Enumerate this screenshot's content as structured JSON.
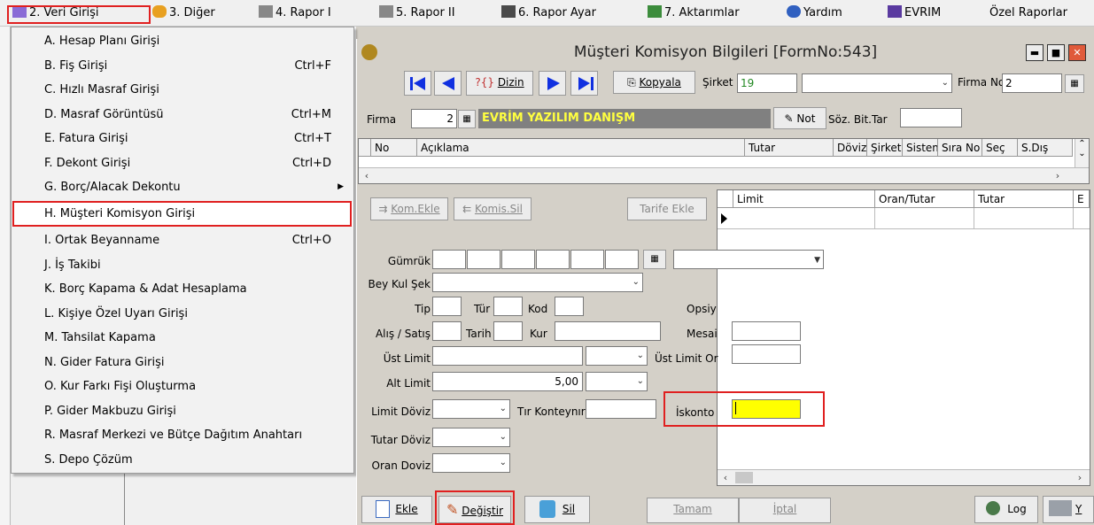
{
  "menubar": {
    "items": [
      {
        "label": "2.  Veri Girişi"
      },
      {
        "label": "3.  Diğer"
      },
      {
        "label": "4.  Rapor I"
      },
      {
        "label": "5.  Rapor II"
      },
      {
        "label": "6.  Rapor Ayar"
      },
      {
        "label": "7.  Aktarımlar"
      },
      {
        "label": "Yardım"
      },
      {
        "label": "EVRIM"
      },
      {
        "label": "Özel Raporlar"
      }
    ]
  },
  "dropdown": {
    "items": [
      {
        "label": "A.  Hesap Planı Girişi",
        "shortcut": ""
      },
      {
        "label": "B.  Fiş Girişi",
        "shortcut": "Ctrl+F"
      },
      {
        "label": "C.  Hızlı Masraf Girişi",
        "shortcut": ""
      },
      {
        "label": "D.  Masraf Görüntüsü",
        "shortcut": "Ctrl+M"
      },
      {
        "label": "E.   Fatura Girişi",
        "shortcut": "Ctrl+T"
      },
      {
        "label": "F.   Dekont Girişi",
        "shortcut": "Ctrl+D"
      },
      {
        "label": "G.  Borç/Alacak Dekontu",
        "shortcut": ""
      },
      {
        "label": "H.  Müşteri Komisyon Girişi",
        "shortcut": ""
      },
      {
        "label": "I.  Ortak Beyanname",
        "shortcut": "Ctrl+O"
      },
      {
        "label": "J.  İş Takibi",
        "shortcut": ""
      },
      {
        "label": "K.  Borç Kapama & Adat Hesaplama",
        "shortcut": ""
      },
      {
        "label": "L.  Kişiye Özel Uyarı Girişi",
        "shortcut": ""
      },
      {
        "label": "M.  Tahsilat Kapama",
        "shortcut": ""
      },
      {
        "label": "N. Gider Fatura Girişi",
        "shortcut": ""
      },
      {
        "label": "O. Kur Farkı Fişi Oluşturma",
        "shortcut": ""
      },
      {
        "label": "P. Gider Makbuzu Girişi",
        "shortcut": ""
      },
      {
        "label": "R. Masraf Merkezi ve Bütçe Dağıtım Anahtarı",
        "shortcut": ""
      },
      {
        "label": "S. Depo Çözüm",
        "shortcut": ""
      }
    ]
  },
  "window": {
    "title": "Müşteri Komisyon Bilgileri [FormNo:543]"
  },
  "toolbar": {
    "dizin": "Dizin",
    "kopyala": "Kopyala",
    "sirket_label": "Şirket",
    "sirket_value": "19",
    "firma_no_label": "Firma No",
    "firma_no_value": "2"
  },
  "firma_row": {
    "label": "Firma",
    "value": "2",
    "name": "EVRİM YAZILIM DANIŞM",
    "not": "Not",
    "soz_bit_tar": "Söz. Bit.Tar"
  },
  "top_grid": {
    "columns": [
      "No",
      "Açıklama",
      "Tutar",
      "Döviz",
      "Şirket",
      "Sistem",
      "Sıra No",
      "Seç",
      "S.Dış"
    ]
  },
  "actions": {
    "kom_ekle": "Kom.Ekle",
    "komis_sil": "Komis.Sil",
    "tarife_ekle": "Tarife Ekle"
  },
  "limit_grid": {
    "columns": [
      "Limit",
      "Oran/Tutar",
      "Tutar",
      "E"
    ]
  },
  "fields": {
    "gumruk": "Gümrük",
    "bey_kul_sek": "Bey Kul Şek",
    "tip": "Tip",
    "tur": "Tür",
    "kod": "Kod",
    "opsiyon": "Opsiy",
    "alis_satis": "Alış / Satış",
    "tarih": "Tarih",
    "kur": "Kur",
    "mesai": "Mesai",
    "ust_limit": "Üst Limit",
    "ust_limit_oran": "Üst Limit Or",
    "alt_limit": "Alt Limit",
    "alt_limit_value": "5,00",
    "iskonto": "İskonto",
    "limit_doviz": "Limit Döviz",
    "tir_konteynir": "Tır Konteynır",
    "tutar_doviz": "Tutar Döviz",
    "oran_doviz": "Oran Doviz"
  },
  "bottom": {
    "ekle": "Ekle",
    "degistir": "Değiştir",
    "sil": "Sil",
    "tamam": "Tamam",
    "iptal": "İptal",
    "log": "Log",
    "y": "Y"
  },
  "colors": {
    "highlight_red": "#e02020",
    "firm_name_bg": "#808080",
    "firm_name_fg": "#ffff40",
    "iskonto_fill": "#ffff00",
    "nav_blue": "#1030e0",
    "close_red": "#e05a3a"
  }
}
